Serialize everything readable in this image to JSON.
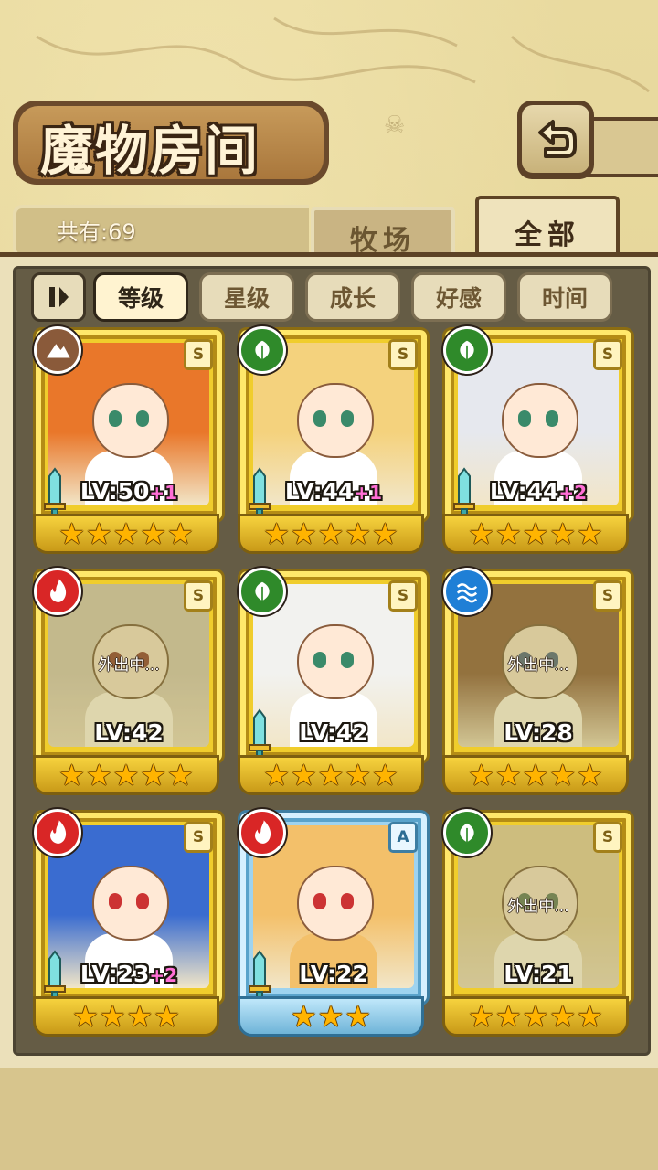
{
  "header": {
    "title": "魔物房间",
    "back_icon": "back-arrow-icon",
    "count_label": "共有:69"
  },
  "tabs": [
    {
      "label": "牧场",
      "active": false
    },
    {
      "label": "全部",
      "active": true
    }
  ],
  "sort": {
    "toggle_icon": "sort-order-icon",
    "options": [
      {
        "label": "等级",
        "active": true
      },
      {
        "label": "星级",
        "active": false
      },
      {
        "label": "成长",
        "active": false
      },
      {
        "label": "好感",
        "active": false
      },
      {
        "label": "时间",
        "active": false
      }
    ]
  },
  "element_colors": {
    "earth": "#8a5a3a",
    "wood": "#2f8a2a",
    "fire": "#d92626",
    "water": "#1f7fd6"
  },
  "monsters": [
    {
      "level": "LV:50",
      "plus": "+1",
      "rank": "S",
      "element": "earth",
      "stars": 5,
      "away": "",
      "frame": "gold",
      "hair": "#e9772a",
      "weapon": true
    },
    {
      "level": "LV:44",
      "plus": "+1",
      "rank": "S",
      "element": "wood",
      "stars": 5,
      "away": "",
      "frame": "gold",
      "hair": "#f4d27d",
      "weapon": true
    },
    {
      "level": "LV:44",
      "plus": "+2",
      "rank": "S",
      "element": "wood",
      "stars": 5,
      "away": "",
      "frame": "gold",
      "hair": "#e6e8ee",
      "weapon": true
    },
    {
      "level": "LV:42",
      "plus": "",
      "rank": "S",
      "element": "fire",
      "stars": 5,
      "away": "外出中...",
      "frame": "gold",
      "hair": "#d8d2c4",
      "weapon": false
    },
    {
      "level": "LV:42",
      "plus": "",
      "rank": "S",
      "element": "wood",
      "stars": 5,
      "away": "",
      "frame": "gold",
      "hair": "#f2f2ef",
      "weapon": true
    },
    {
      "level": "LV:28",
      "plus": "",
      "rank": "S",
      "element": "water",
      "stars": 5,
      "away": "外出中...",
      "frame": "gold",
      "hair": "#b05a34",
      "weapon": false
    },
    {
      "level": "LV:23",
      "plus": "+2",
      "rank": "S",
      "element": "fire",
      "stars": 4,
      "away": "",
      "frame": "gold",
      "hair": "#3a6cd0",
      "weapon": true
    },
    {
      "level": "LV:22",
      "plus": "",
      "rank": "A",
      "element": "fire",
      "stars": 3,
      "away": "",
      "frame": "blue",
      "hair": "#f3c06a",
      "weapon": true
    },
    {
      "level": "LV:21",
      "plus": "",
      "rank": "S",
      "element": "wood",
      "stars": 5,
      "away": "外出中...",
      "frame": "gold",
      "hair": "#f2d98a",
      "weapon": false
    }
  ]
}
